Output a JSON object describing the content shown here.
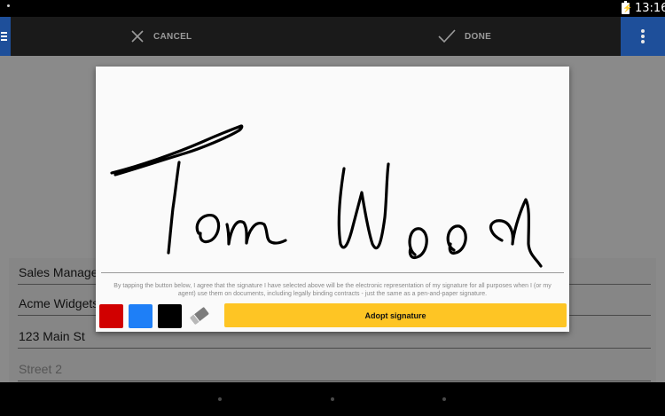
{
  "status_bar": {
    "time": "13:16",
    "icons": [
      "notification-dot",
      "battery-charging-icon"
    ]
  },
  "action_bar": {
    "cancel_label": "CANCEL",
    "done_label": "DONE",
    "icons": [
      "menu-icon",
      "close-icon",
      "check-icon",
      "overflow-menu-icon"
    ],
    "accent_color": "#1e4f9a"
  },
  "form": {
    "fields": [
      {
        "value": "Sales Manager"
      },
      {
        "value": "Acme Widgets"
      },
      {
        "value": "123 Main St"
      },
      {
        "placeholder": "Street 2"
      }
    ]
  },
  "signature_dialog": {
    "signature_text": "Tom Wood",
    "agreement_text": "By tapping the button below, I agree that the signature I have selected above will be the electronic representation of my signature for all purposes when I (or my agent) use them on documents, including legally binding contracts - just the same as a pen-and-paper signature.",
    "colors": [
      {
        "name": "red",
        "hex": "#d10000"
      },
      {
        "name": "blue",
        "hex": "#1e7ff7"
      },
      {
        "name": "black",
        "hex": "#000000"
      }
    ],
    "eraser_icon": "eraser-icon",
    "adopt_label": "Adopt signature",
    "adopt_color": "#fec524"
  },
  "nav_bar": {
    "icons": [
      "back-icon",
      "home-icon",
      "recents-icon"
    ]
  }
}
